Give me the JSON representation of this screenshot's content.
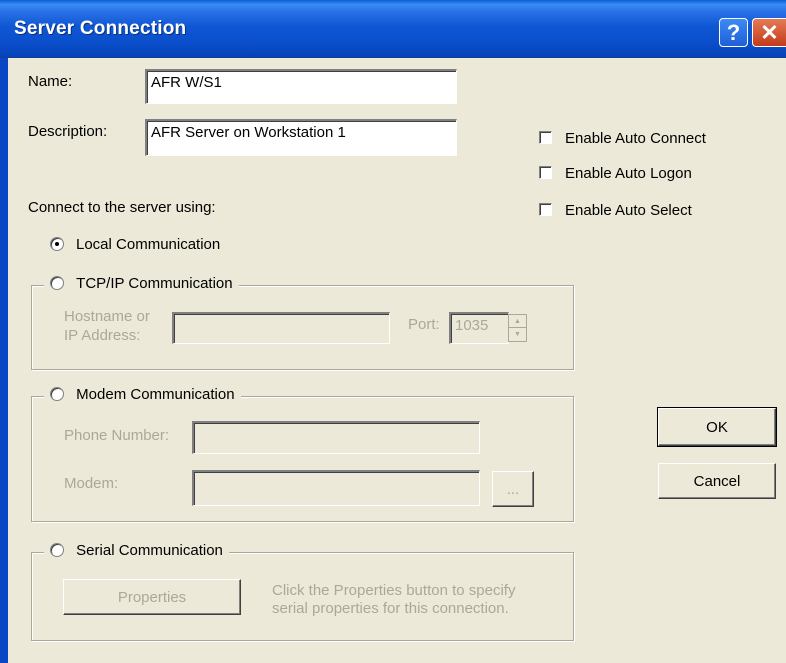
{
  "window": {
    "title": "Server Connection",
    "help_glyph": "?",
    "close_glyph": "✕"
  },
  "form": {
    "name_label": "Name:",
    "name_value": "AFR W/S1",
    "description_label": "Description:",
    "description_value": "AFR Server on Workstation 1",
    "connect_label": "Connect to the server using:"
  },
  "options": {
    "auto_connect": "Enable Auto Connect",
    "auto_logon": "Enable Auto Logon",
    "auto_select": "Enable Auto Select"
  },
  "local": {
    "label": "Local Communication",
    "selected": true
  },
  "tcpip": {
    "label": "TCP/IP Communication",
    "host_label_1": "Hostname or",
    "host_label_2": "IP Address:",
    "host_value": "",
    "port_label": "Port:",
    "port_value": "1035"
  },
  "modem": {
    "label": "Modem Communication",
    "phone_label": "Phone Number:",
    "phone_value": "",
    "modem_label": "Modem:",
    "modem_value": "",
    "browse_label": "..."
  },
  "serial": {
    "label": "Serial Communication",
    "properties_button": "Properties",
    "hint_line1": "Click the Properties button to specify",
    "hint_line2": "serial properties for this connection."
  },
  "buttons": {
    "ok": "OK",
    "cancel": "Cancel"
  },
  "colors": {
    "dialog_bg": "#ECE9D8",
    "title_blue": "#0A4ECB",
    "disabled_text": "#ACA899",
    "close_red": "#C23B1A"
  }
}
